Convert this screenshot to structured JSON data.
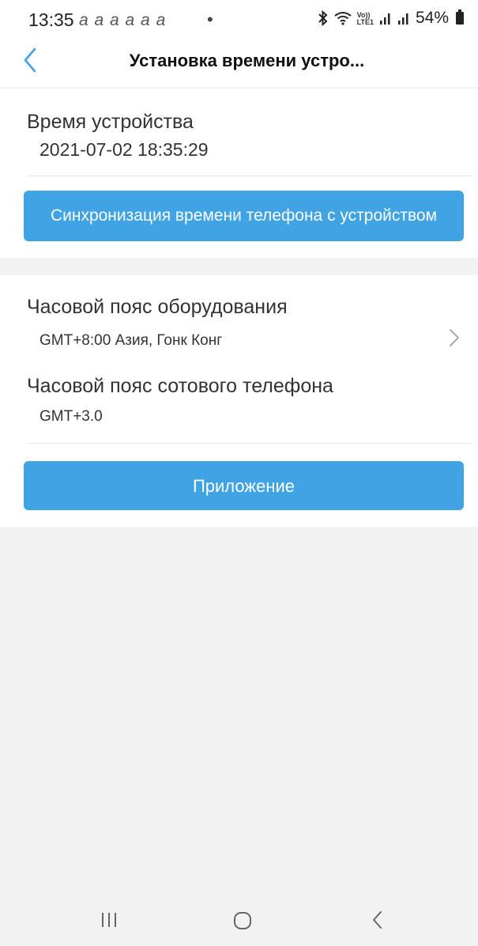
{
  "status_bar": {
    "time": "13:35",
    "notifications": "a a a a a a",
    "dot": "•",
    "battery": "54%",
    "volte_top": "Vo))",
    "volte_bottom": "LTE1"
  },
  "header": {
    "title": "Установка времени устро..."
  },
  "device_time": {
    "label": "Время устройства",
    "value": "2021-07-02 18:35:29",
    "sync_button": "Синхронизация времени телефона с устройством"
  },
  "timezone": {
    "device_label": "Часовой пояс оборудования",
    "device_value": "GMT+8:00 Азия, Гонк Конг",
    "phone_label": "Часовой пояс сотового телефона",
    "phone_value": "GMT+3.0",
    "apply_button": "Приложение"
  },
  "colors": {
    "accent": "#3fa3e4",
    "background": "#f2f2f2"
  },
  "icons": {
    "back": "chevron-left-icon",
    "row_arrow": "chevron-right-icon",
    "bluetooth": "bluetooth-icon",
    "wifi": "wifi-icon",
    "signal": "signal-icon",
    "battery": "battery-icon"
  }
}
